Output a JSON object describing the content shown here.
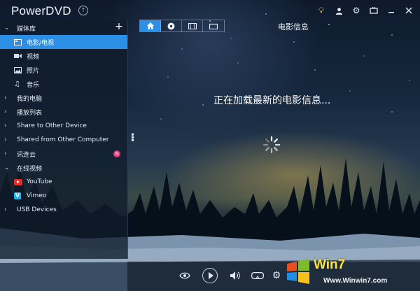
{
  "app": {
    "title": "PowerDVD",
    "badge_glyph": "↑"
  },
  "window_icons": [
    "lightbulb-icon",
    "user-icon",
    "gear-icon",
    "tv-icon",
    "minimize-icon",
    "close-icon"
  ],
  "sidebar": {
    "media_library": {
      "label": "媒体库",
      "items": [
        {
          "label": "电影/电视",
          "icon": "movie-icon",
          "selected": true
        },
        {
          "label": "视频",
          "icon": "video-icon"
        },
        {
          "label": "照片",
          "icon": "photo-icon"
        },
        {
          "label": "音乐",
          "icon": "music-icon"
        }
      ]
    },
    "sections": [
      {
        "label": "我的电脑"
      },
      {
        "label": "播放列表"
      },
      {
        "label": "Share to Other Device"
      },
      {
        "label": "Shared from Other Computer"
      },
      {
        "label": "讯连云",
        "badge": "N"
      }
    ],
    "online_video": {
      "label": "在线视频",
      "items": [
        {
          "label": "YouTube",
          "icon": "youtube-icon"
        },
        {
          "label": "Vimeo",
          "icon": "vimeo-icon"
        }
      ]
    },
    "usb": {
      "label": "USB Devices"
    }
  },
  "tabs": [
    {
      "icon": "home-icon",
      "active": true
    },
    {
      "icon": "disc-icon"
    },
    {
      "icon": "film-icon"
    },
    {
      "icon": "tv-icon"
    }
  ],
  "main": {
    "section_title": "电影信息",
    "loading_message": "正在加载最新的电影信息..."
  },
  "bottom_controls": [
    "eye-icon",
    "play-icon",
    "volume-icon",
    "vr-icon",
    "settings-icon"
  ],
  "watermark": {
    "text": "Win7",
    "url": "Www.Winwin7.com"
  },
  "colors": {
    "accent": "#2b8fe6",
    "badge": "#e43a7a",
    "youtube": "#e52d27",
    "vimeo": "#1ab7ea"
  }
}
